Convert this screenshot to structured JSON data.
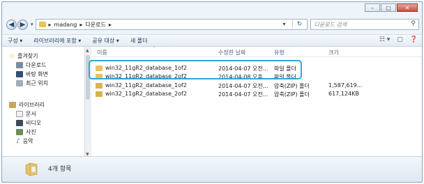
{
  "window": {
    "buttons": [
      "–",
      "□",
      "✕"
    ]
  },
  "address": {
    "path": [
      "madang",
      "다운로드"
    ],
    "search_placeholder": "다운로드 검색"
  },
  "toolbar": {
    "organize": "구성 ▾",
    "include_library": "라이브러리에 포함 ▾",
    "share": "공유 대상 ▾",
    "new_folder": "새 폴더"
  },
  "nav": {
    "favorites": "즐겨찾기",
    "downloads": "다운로드",
    "desktop": "바탕 화면",
    "recent": "최근 위치",
    "libraries": "라이브러리",
    "documents": "문서",
    "videos": "비디오",
    "pictures": "사진",
    "music": "음악"
  },
  "columns": {
    "name": "이름",
    "modified": "수정한 날짜",
    "type": "유형",
    "size": "크기"
  },
  "files": [
    {
      "name": "win32_11gR2_database_1of2",
      "modified": "2014-04-07 오전...",
      "type": "파일 폴더",
      "size": ""
    },
    {
      "name": "win32_11gR2_database_2of2",
      "modified": "2014-04-08 오후...",
      "type": "파일 폴더",
      "size": ""
    },
    {
      "name": "win32_11gR2_database_1of2",
      "modified": "2014-04-07 오전...",
      "type": "압축(ZIP) 폴더",
      "size": "1,587,619..."
    },
    {
      "name": "win32_11gR2_database_2of2",
      "modified": "2014-04-07 오전...",
      "type": "압축(ZIP) 폴더",
      "size": "617,124KB"
    }
  ],
  "status": {
    "count": "4개 항목"
  },
  "colors": {
    "highlight": "#2ea8d8",
    "folder": "#e8c35a",
    "zip": "#d8b44a"
  }
}
